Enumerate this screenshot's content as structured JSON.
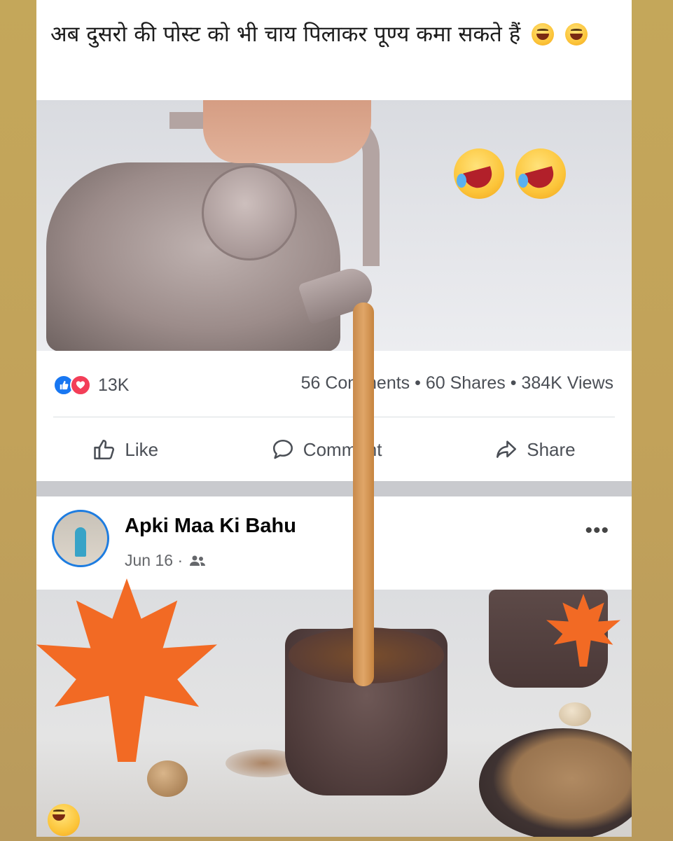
{
  "caption": {
    "text": "अब दुसरो की पोस्ट को भी चाय पिलाकर पूण्य कमा सकते हैं",
    "emoji_icons": [
      "laughing-face-icon",
      "grinning-face-icon"
    ]
  },
  "post": {
    "reactions_count": "13K",
    "stats": "56 Comments • 60 Shares • 384K Views",
    "actions": {
      "like": "Like",
      "comment": "Comment",
      "share": "Share"
    },
    "page_name": "Apki Maa Ki Bahu",
    "date": "Jun 16 ·",
    "more_icon": "more-dots-icon",
    "audience_icon": "friends-icon"
  },
  "overlay_emojis": [
    "rolling-on-floor-laughing-icon",
    "rolling-on-floor-laughing-icon",
    "grinning-face-icon"
  ],
  "colors": {
    "background_border": "#c4a75a",
    "like_blue": "#1877f2",
    "love_red": "#f33e58",
    "leaf_orange": "#f26a24",
    "tea": "#d99a5a"
  }
}
